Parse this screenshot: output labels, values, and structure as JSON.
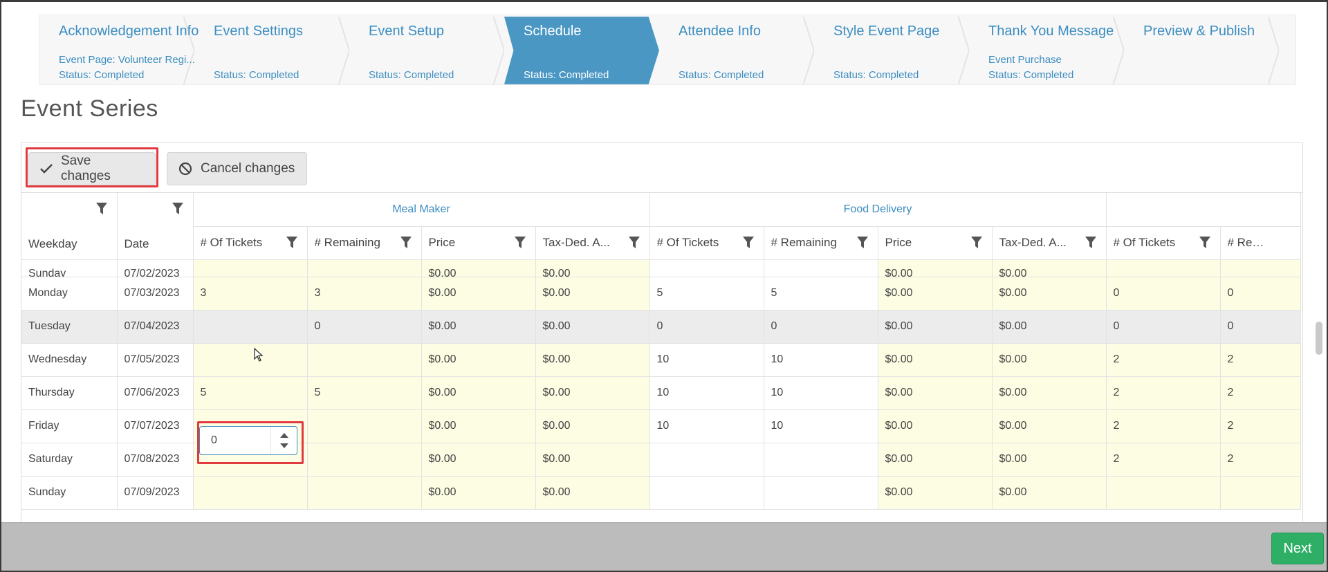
{
  "steps": [
    {
      "title": "Acknowledgement Info",
      "line1": "Event Page: Volunteer Regi...",
      "line2": "Status: Completed"
    },
    {
      "title": "Event Settings",
      "line1": "",
      "line2": "Status: Completed"
    },
    {
      "title": "Event Setup",
      "line1": "",
      "line2": "Status: Completed"
    },
    {
      "title": "Schedule",
      "line1": "",
      "line2": "Status: Completed"
    },
    {
      "title": "Attendee Info",
      "line1": "",
      "line2": "Status: Completed"
    },
    {
      "title": "Style Event Page",
      "line1": "",
      "line2": "Status: Completed"
    },
    {
      "title": "Thank You Message",
      "line1": "Event Purchase",
      "line2": "Status: Completed"
    },
    {
      "title": "Preview & Publish",
      "line1": "",
      "line2": ""
    }
  ],
  "page_title": "Event Series",
  "toolbar": {
    "save_label": "Save changes",
    "cancel_label": "Cancel changes"
  },
  "groups": {
    "meal_maker": "Meal Maker",
    "food_delivery": "Food Delivery",
    "third": ""
  },
  "columns": [
    "Weekday",
    "Date",
    "# Of Tickets",
    "# Remaining",
    "Price",
    "Tax-Ded. A...",
    "# Of Tickets",
    "# Remaining",
    "Price",
    "Tax-Ded. A...",
    "# Of Tickets",
    "# Remaining"
  ],
  "rows": [
    [
      "Sunday",
      "07/02/2023",
      "",
      "",
      "$0.00",
      "$0.00",
      "",
      "",
      "$0.00",
      "$0.00",
      "",
      ""
    ],
    [
      "Monday",
      "07/03/2023",
      "3",
      "3",
      "$0.00",
      "$0.00",
      "5",
      "5",
      "$0.00",
      "$0.00",
      "0",
      "0"
    ],
    [
      "Tuesday",
      "07/04/2023",
      "",
      "0",
      "$0.00",
      "$0.00",
      "0",
      "0",
      "$0.00",
      "$0.00",
      "0",
      "0"
    ],
    [
      "Wednesday",
      "07/05/2023",
      "",
      "",
      "$0.00",
      "$0.00",
      "10",
      "10",
      "$0.00",
      "$0.00",
      "2",
      "2"
    ],
    [
      "Thursday",
      "07/06/2023",
      "5",
      "5",
      "$0.00",
      "$0.00",
      "10",
      "10",
      "$0.00",
      "$0.00",
      "2",
      "2"
    ],
    [
      "Friday",
      "07/07/2023",
      "",
      "",
      "$0.00",
      "$0.00",
      "10",
      "10",
      "$0.00",
      "$0.00",
      "2",
      "2"
    ],
    [
      "Saturday",
      "07/08/2023",
      "",
      "",
      "$0.00",
      "$0.00",
      "",
      "",
      "$0.00",
      "$0.00",
      "2",
      "2"
    ],
    [
      "Sunday",
      "07/09/2023",
      "",
      "",
      "$0.00",
      "$0.00",
      "",
      "",
      "$0.00",
      "$0.00",
      "",
      ""
    ]
  ],
  "editor": {
    "value": "0"
  },
  "footer": {
    "next_label": "Next"
  },
  "colors": {
    "accent": "#3b8dc0",
    "active_step": "#4a97c4",
    "highlight": "#e0393e",
    "next": "#2faf66",
    "editable_cell": "#fdfde4"
  }
}
